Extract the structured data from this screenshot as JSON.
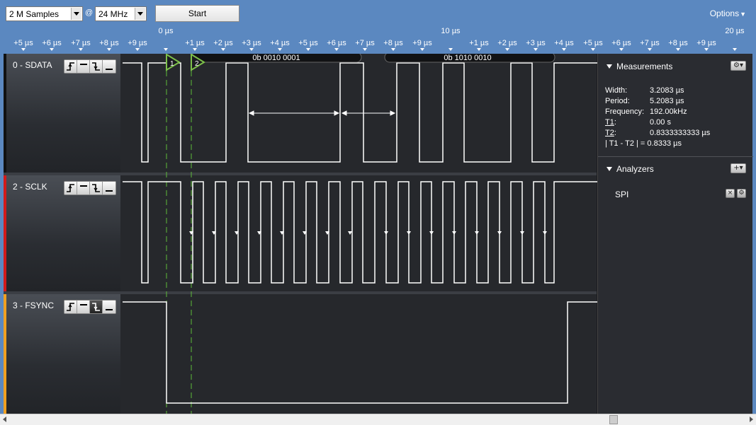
{
  "toolbar": {
    "samples_value": "2 M Samples",
    "at_sign": "@",
    "rate_value": "24 MHz",
    "start_label": "Start",
    "options_label": "Options"
  },
  "ruler": {
    "labels": [
      "+5 µs",
      "+6 µs",
      "+7 µs",
      "+8 µs",
      "+9 µs",
      "0 µs",
      "+1 µs",
      "+2 µs",
      "+3 µs",
      "+4 µs",
      "+5 µs",
      "+6 µs",
      "+7 µs",
      "+8 µs",
      "+9 µs",
      "10 µs",
      "+1 µs",
      "+2 µs",
      "+3 µs",
      "+4 µs",
      "+5 µs",
      "+6 µs",
      "+7 µs",
      "+8 µs",
      "+9 µs",
      "20 µs"
    ]
  },
  "channels": [
    {
      "name": "0 - SDATA",
      "color": "#111111"
    },
    {
      "name": "2 - SCLK",
      "color": "#d21a1a"
    },
    {
      "name": "3 - FSYNC",
      "color": "#f0a020"
    }
  ],
  "markers": {
    "t1": "1",
    "t2": "2"
  },
  "decoded": {
    "byte1": "0b  0010  0001",
    "byte2": "0b  1010  0010"
  },
  "measurements": {
    "title": "Measurements",
    "width_label": "Width:",
    "width_value": "3.2083 µs",
    "period_label": "Period:",
    "period_value": "5.2083 µs",
    "freq_label": "Frequency:",
    "freq_value": "192.00kHz",
    "t1_label": "T1",
    "t1_value": "0.00 s",
    "t2_label": "T2",
    "t2_value": "0.8333333333 µs",
    "diff_label": "| T1 - T2 | = 0.8333 µs"
  },
  "analyzers": {
    "title": "Analyzers",
    "items": [
      "SPI"
    ]
  },
  "icons": {
    "gear": "gear-icon",
    "plus": "plus-icon",
    "close": "close-icon"
  }
}
